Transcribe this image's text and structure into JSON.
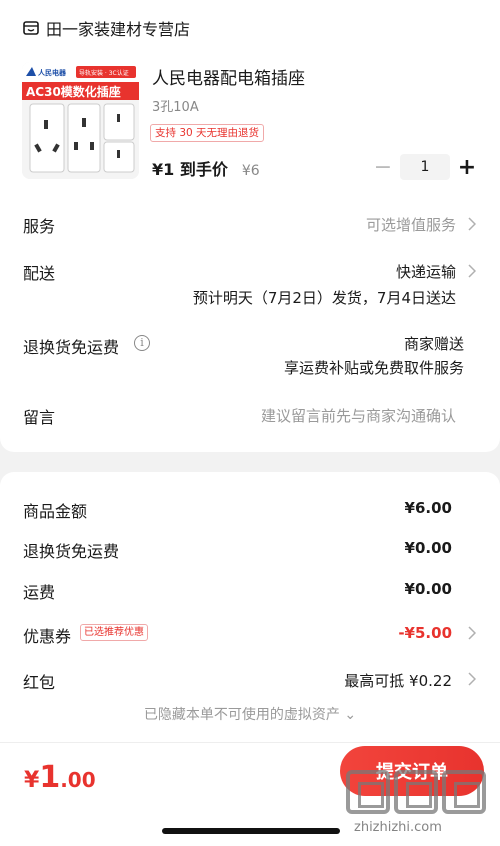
{
  "store": {
    "name": "田一家装建材专营店",
    "icon": "shop-icon"
  },
  "product": {
    "title": "人民电器配电箱插座",
    "spec": "3孔10A",
    "tag": "支持 30 天无理由退货",
    "price": "¥1 到手价",
    "original_price": "¥6",
    "quantity": "1",
    "image": {
      "brand": "人民电器",
      "badge": "导轨安装 · 3C认证",
      "headline": "AC30模数化插座"
    }
  },
  "rows": {
    "service": {
      "label": "服务",
      "value": "可选增值服务"
    },
    "delivery": {
      "label": "配送",
      "value": "快递运输",
      "detail": "预计明天（7月2日）发货，7月4日送达"
    },
    "return": {
      "label": "退换货免运费",
      "value": "商家赠送",
      "detail": "享运费补贴或免费取件服务"
    },
    "note": {
      "label": "留言",
      "placeholder": "建议留言前先与商家沟通确认"
    }
  },
  "summary": {
    "goods_amount": {
      "label": "商品金额",
      "value": "¥6.00"
    },
    "return_fee": {
      "label": "退换货免运费",
      "value": "¥0.00"
    },
    "shipping": {
      "label": "运费",
      "value": "¥0.00"
    },
    "coupon": {
      "label": "优惠券",
      "tag": "已选推荐优惠",
      "value": "-¥5.00"
    },
    "red_packet": {
      "label": "红包",
      "value": "最高可抵 ¥0.22"
    },
    "hidden_note": "已隐藏本单不可使用的虚拟资产 ⌄"
  },
  "footer": {
    "currency": "¥",
    "total_int": "1",
    "total_dec": ".00",
    "submit": "提交订单"
  },
  "watermark": {
    "text": "zhizhizhi.com"
  },
  "colors": {
    "accent": "#e8332e",
    "muted": "#9a9a9a",
    "background": "#f2f2f2"
  }
}
